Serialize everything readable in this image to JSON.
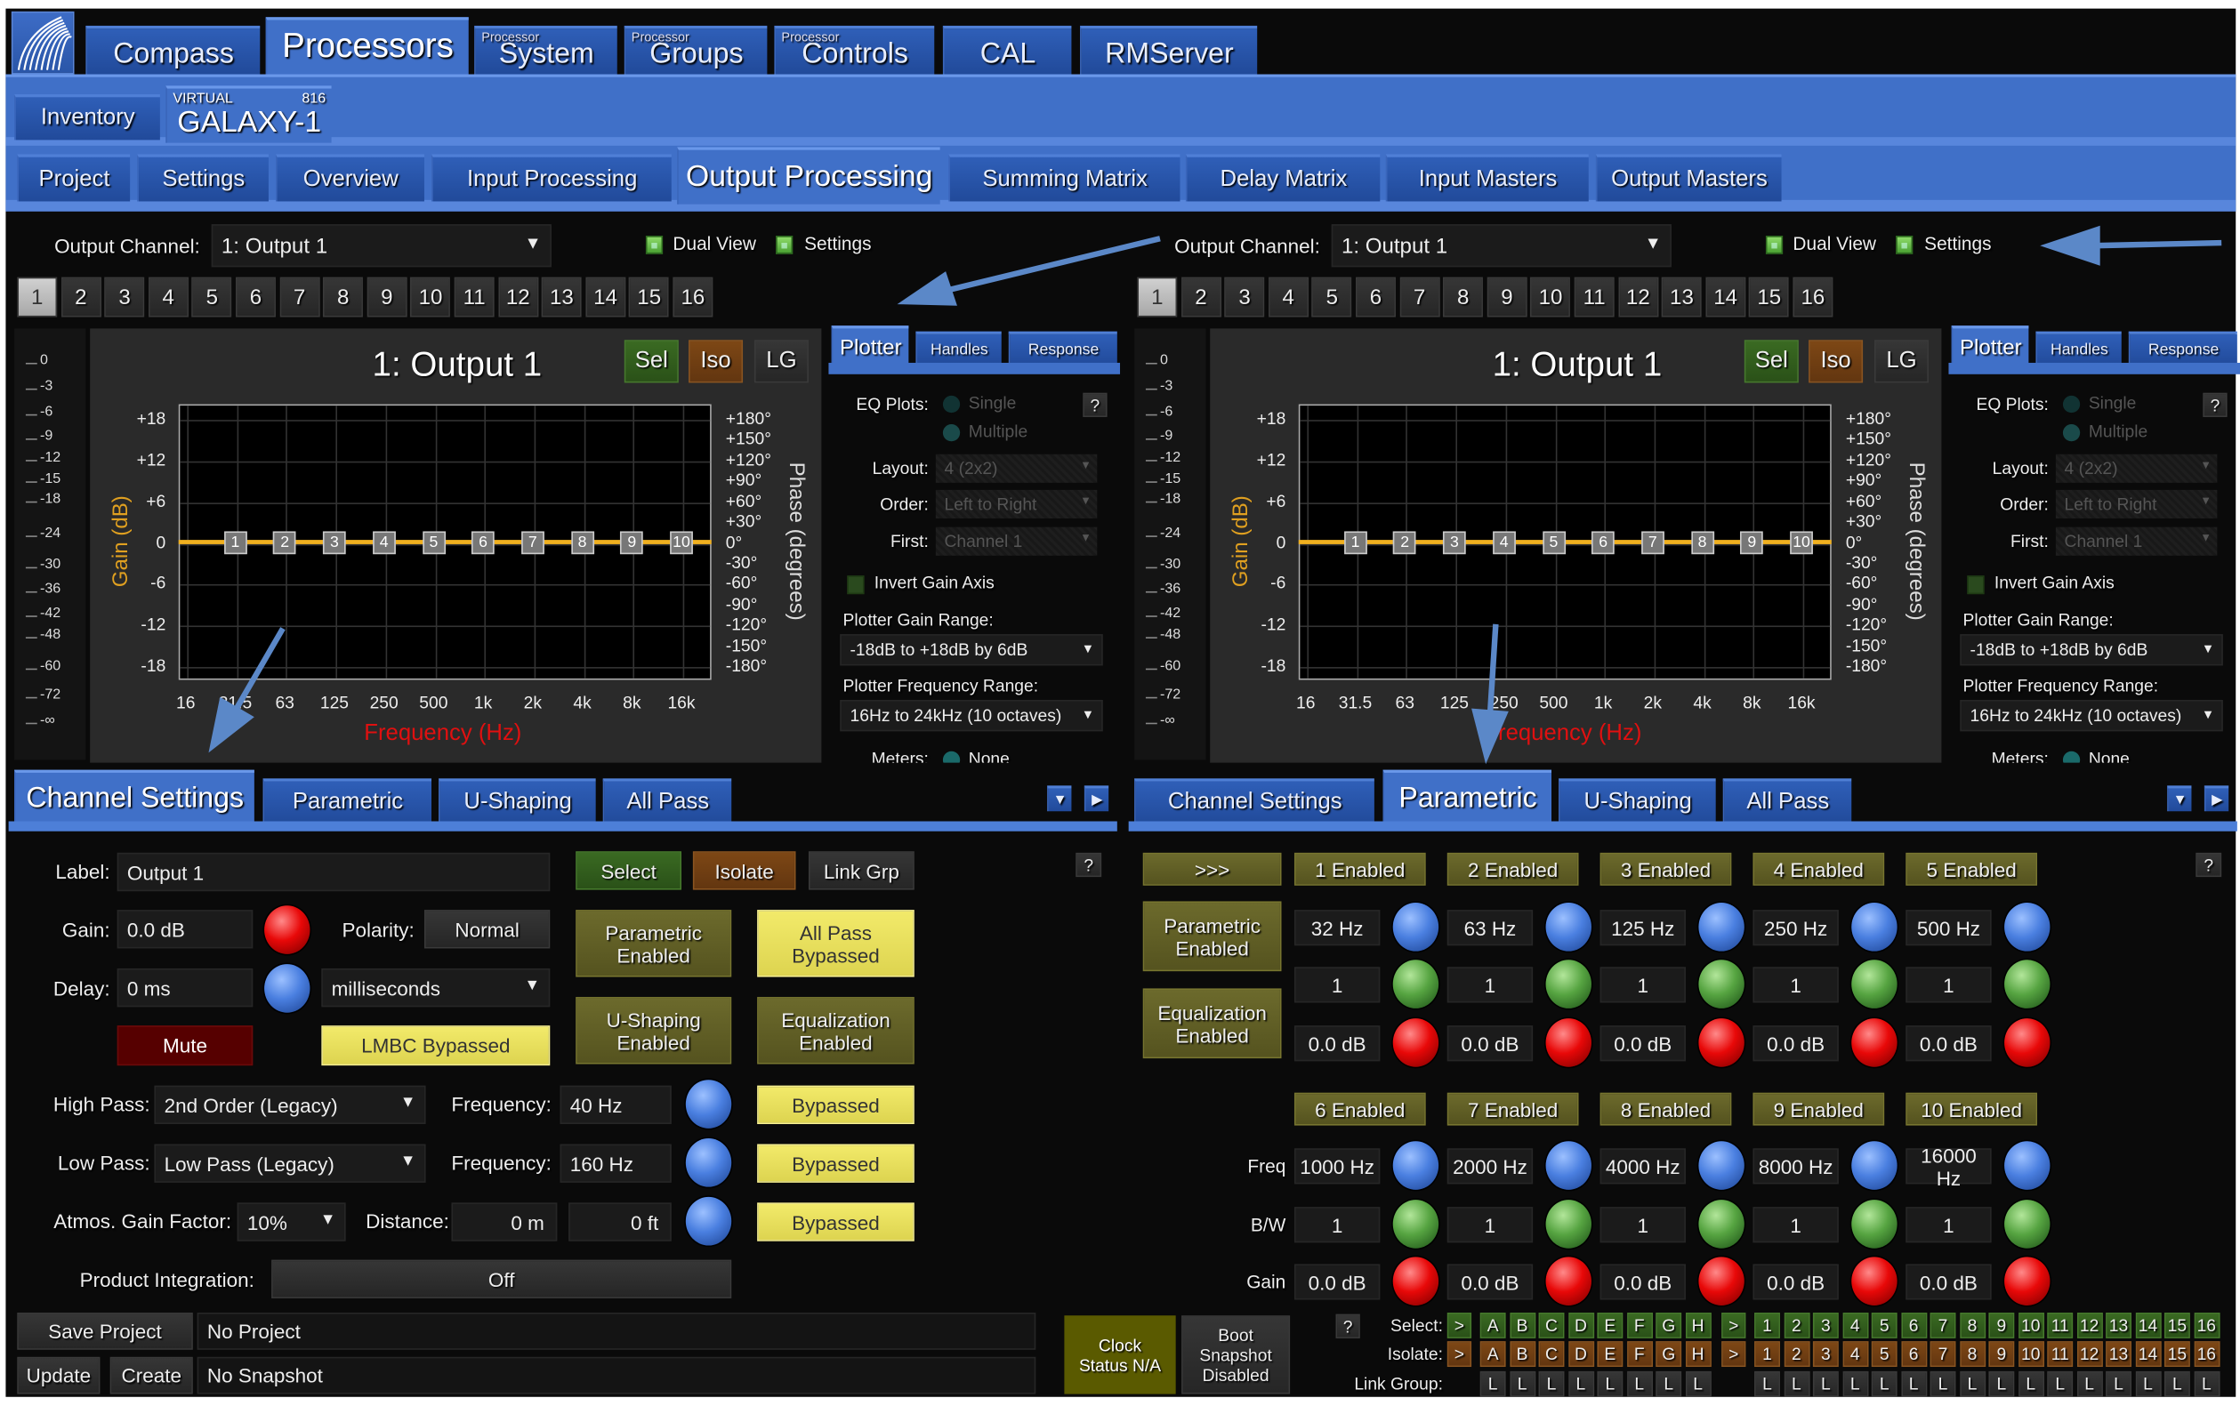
{
  "colors": {
    "band_blue": "#4070c8",
    "tab_blue": "#2a56a8",
    "curve": "#f0b020",
    "gain_axis": "#e0a020",
    "freq_axis": "#e01010",
    "arrow": "#5b88c8"
  },
  "nav": {
    "logo": "meyer-sound-logo",
    "tabs": [
      {
        "sup": "",
        "label": "Compass"
      },
      {
        "sup": "",
        "label": "Processors",
        "active": true
      },
      {
        "sup": "Processor",
        "label": "System"
      },
      {
        "sup": "Processor",
        "label": "Groups"
      },
      {
        "sup": "Processor",
        "label": "Controls"
      },
      {
        "sup": "",
        "label": "CAL"
      },
      {
        "sup": "",
        "label": "RMServer"
      }
    ]
  },
  "device_tabs": [
    {
      "label": "Inventory"
    },
    {
      "sup_left": "VIRTUAL",
      "sup_right": "816",
      "label": "GALAXY-1",
      "active": true
    }
  ],
  "section_tabs": [
    {
      "label": "Project"
    },
    {
      "label": "Settings"
    },
    {
      "label": "Overview"
    },
    {
      "label": "Input Processing"
    },
    {
      "label": "Output Processing",
      "active": true
    },
    {
      "label": "Summing Matrix"
    },
    {
      "label": "Delay Matrix"
    },
    {
      "label": "Input Masters"
    },
    {
      "label": "Output Masters"
    }
  ],
  "channel_view": {
    "output_channel_label": "Output Channel:",
    "output_channel_value": "1: Output 1",
    "dual_view_label": "Dual View",
    "dual_view_checked": true,
    "settings_label": "Settings",
    "settings_checked": true,
    "channels": [
      "1",
      "2",
      "3",
      "4",
      "5",
      "6",
      "7",
      "8",
      "9",
      "10",
      "11",
      "12",
      "13",
      "14",
      "15",
      "16"
    ],
    "selected_channel": "1",
    "meter_ticks": [
      "0",
      "-3",
      "-6",
      "-9",
      "-12",
      "-15",
      "-18",
      "-24",
      "-30",
      "-36",
      "-42",
      "-48",
      "-60",
      "-72",
      "-∞"
    ],
    "plot": {
      "title": "1: Output 1",
      "sel": "Sel",
      "iso": "Iso",
      "lg": "LG",
      "ylabel": "Gain (dB)",
      "xlabel": "Frequency (Hz)",
      "y2label": "Phase (degrees)",
      "ylim": [
        -20,
        20
      ],
      "gain_ticks": [
        {
          "v": 18,
          "t": "+18"
        },
        {
          "v": 12,
          "t": "+12"
        },
        {
          "v": 6,
          "t": "+6"
        },
        {
          "v": 0,
          "t": "0"
        },
        {
          "v": -6,
          "t": "-6"
        },
        {
          "v": -12,
          "t": "-12"
        },
        {
          "v": -18,
          "t": "-18"
        }
      ],
      "phase_ticks": [
        "+180°",
        "+150°",
        "+120°",
        "+90°",
        "+60°",
        "+30°",
        "0°",
        "-30°",
        "-60°",
        "-90°",
        "-120°",
        "-150°",
        "-180°"
      ],
      "freq_ticks": [
        "16",
        "31.5",
        "63",
        "125",
        "250",
        "500",
        "1k",
        "2k",
        "4k",
        "8k",
        "16k"
      ],
      "curve_gain_db": 0,
      "handles": [
        {
          "label": "1",
          "freq": "31.5",
          "gain": 0
        },
        {
          "label": "2",
          "freq": "63",
          "gain": 0
        },
        {
          "label": "3",
          "freq": "125",
          "gain": 0
        },
        {
          "label": "4",
          "freq": "250",
          "gain": 0
        },
        {
          "label": "5",
          "freq": "500",
          "gain": 0
        },
        {
          "label": "6",
          "freq": "1k",
          "gain": 0
        },
        {
          "label": "7",
          "freq": "2k",
          "gain": 0
        },
        {
          "label": "8",
          "freq": "4k",
          "gain": 0
        },
        {
          "label": "9",
          "freq": "8k",
          "gain": 0
        },
        {
          "label": "10",
          "freq": "16k",
          "gain": 0
        }
      ]
    },
    "plotter_tabs": [
      {
        "label": "Plotter",
        "active": true
      },
      {
        "label": "Handles"
      },
      {
        "label": "Response"
      }
    ],
    "plotter": {
      "eq_plots_label": "EQ Plots:",
      "single": "Single",
      "multiple": "Multiple",
      "help": "?",
      "layout_label": "Layout:",
      "layout_value": "4 (2x2)",
      "order_label": "Order:",
      "order_value": "Left to Right",
      "first_label": "First:",
      "first_value": "Channel 1",
      "invert_label": "Invert Gain Axis",
      "gain_range_label": "Plotter Gain Range:",
      "gain_range_value": "-18dB to +18dB by 6dB",
      "freq_range_label": "Plotter Frequency Range:",
      "freq_range_value": "16Hz to 24kHz (10 octaves)",
      "meters_label": "Meters:",
      "meters_value": "None"
    },
    "bottom_tabs": [
      "Channel Settings",
      "Parametric",
      "U-Shaping",
      "All Pass"
    ]
  },
  "panels": [
    {
      "active_tab": 0
    },
    {
      "active_tab": 1
    }
  ],
  "channel_settings": {
    "label_label": "Label:",
    "label_value": "Output 1",
    "gain_label": "Gain:",
    "gain_value": "0.0 dB",
    "polarity_label": "Polarity:",
    "polarity_value": "Normal",
    "delay_label": "Delay:",
    "delay_value": "0 ms",
    "delay_unit": "milliseconds",
    "mute": "Mute",
    "lmbc": "LMBC Bypassed",
    "select": "Select",
    "isolate": "Isolate",
    "link_grp": "Link Grp",
    "help": "?",
    "parametric": "Parametric Enabled",
    "all_pass": "All Pass Bypassed",
    "u_shaping": "U-Shaping Enabled",
    "equalization": "Equalization Enabled",
    "high_pass_label": "High Pass:",
    "high_pass_value": "2nd Order  (Legacy)",
    "hp_freq_label": "Frequency:",
    "hp_freq_value": "40 Hz",
    "hp_state": "Bypassed",
    "low_pass_label": "Low Pass:",
    "low_pass_value": "Low Pass (Legacy)",
    "lp_freq_label": "Frequency:",
    "lp_freq_value": "160 Hz",
    "lp_state": "Bypassed",
    "atmos_label": "Atmos. Gain Factor:",
    "atmos_value": "10%",
    "distance_label": "Distance:",
    "distance_m": "0 m",
    "distance_ft": "0 ft",
    "atmos_state": "Bypassed",
    "product_integration_label": "Product Integration:",
    "product_integration_value": "Off"
  },
  "parametric": {
    "expand": ">>>",
    "help": "?",
    "parametric_enabled": "Parametric Enabled",
    "equalization_enabled": "Equalization Enabled",
    "row_labels": {
      "freq": "Freq",
      "bw": "B/W",
      "gain": "Gain"
    },
    "bands": [
      {
        "state": "1 Enabled",
        "freq": "32 Hz",
        "bw": "1",
        "gain": "0.0 dB"
      },
      {
        "state": "2 Enabled",
        "freq": "63 Hz",
        "bw": "1",
        "gain": "0.0 dB"
      },
      {
        "state": "3 Enabled",
        "freq": "125 Hz",
        "bw": "1",
        "gain": "0.0 dB"
      },
      {
        "state": "4 Enabled",
        "freq": "250 Hz",
        "bw": "1",
        "gain": "0.0 dB"
      },
      {
        "state": "5 Enabled",
        "freq": "500 Hz",
        "bw": "1",
        "gain": "0.0 dB"
      },
      {
        "state": "6 Enabled",
        "freq": "1000 Hz",
        "bw": "1",
        "gain": "0.0 dB"
      },
      {
        "state": "7 Enabled",
        "freq": "2000 Hz",
        "bw": "1",
        "gain": "0.0 dB"
      },
      {
        "state": "8 Enabled",
        "freq": "4000 Hz",
        "bw": "1",
        "gain": "0.0 dB"
      },
      {
        "state": "9 Enabled",
        "freq": "8000 Hz",
        "bw": "1",
        "gain": "0.0 dB"
      },
      {
        "state": "10 Enabled",
        "freq": "16000 Hz",
        "bw": "1",
        "gain": "0.0 dB"
      }
    ]
  },
  "groups": {
    "help": "?",
    "select_label": "Select:",
    "isolate_label": "Isolate:",
    "link_label": "Link Group:",
    "arrow": ">",
    "letters": [
      "A",
      "B",
      "C",
      "D",
      "E",
      "F",
      "G",
      "H"
    ],
    "numbers": [
      "1",
      "2",
      "3",
      "4",
      "5",
      "6",
      "7",
      "8",
      "9",
      "10",
      "11",
      "12",
      "13",
      "14",
      "15",
      "16"
    ],
    "link": "L"
  },
  "footer": {
    "save_project": "Save Project",
    "project_value": "No Project",
    "update": "Update",
    "create": "Create",
    "snapshot_value": "No Snapshot",
    "clock_status": "Clock Status N/A",
    "boot_snapshot": "Boot Snapshot Disabled"
  }
}
